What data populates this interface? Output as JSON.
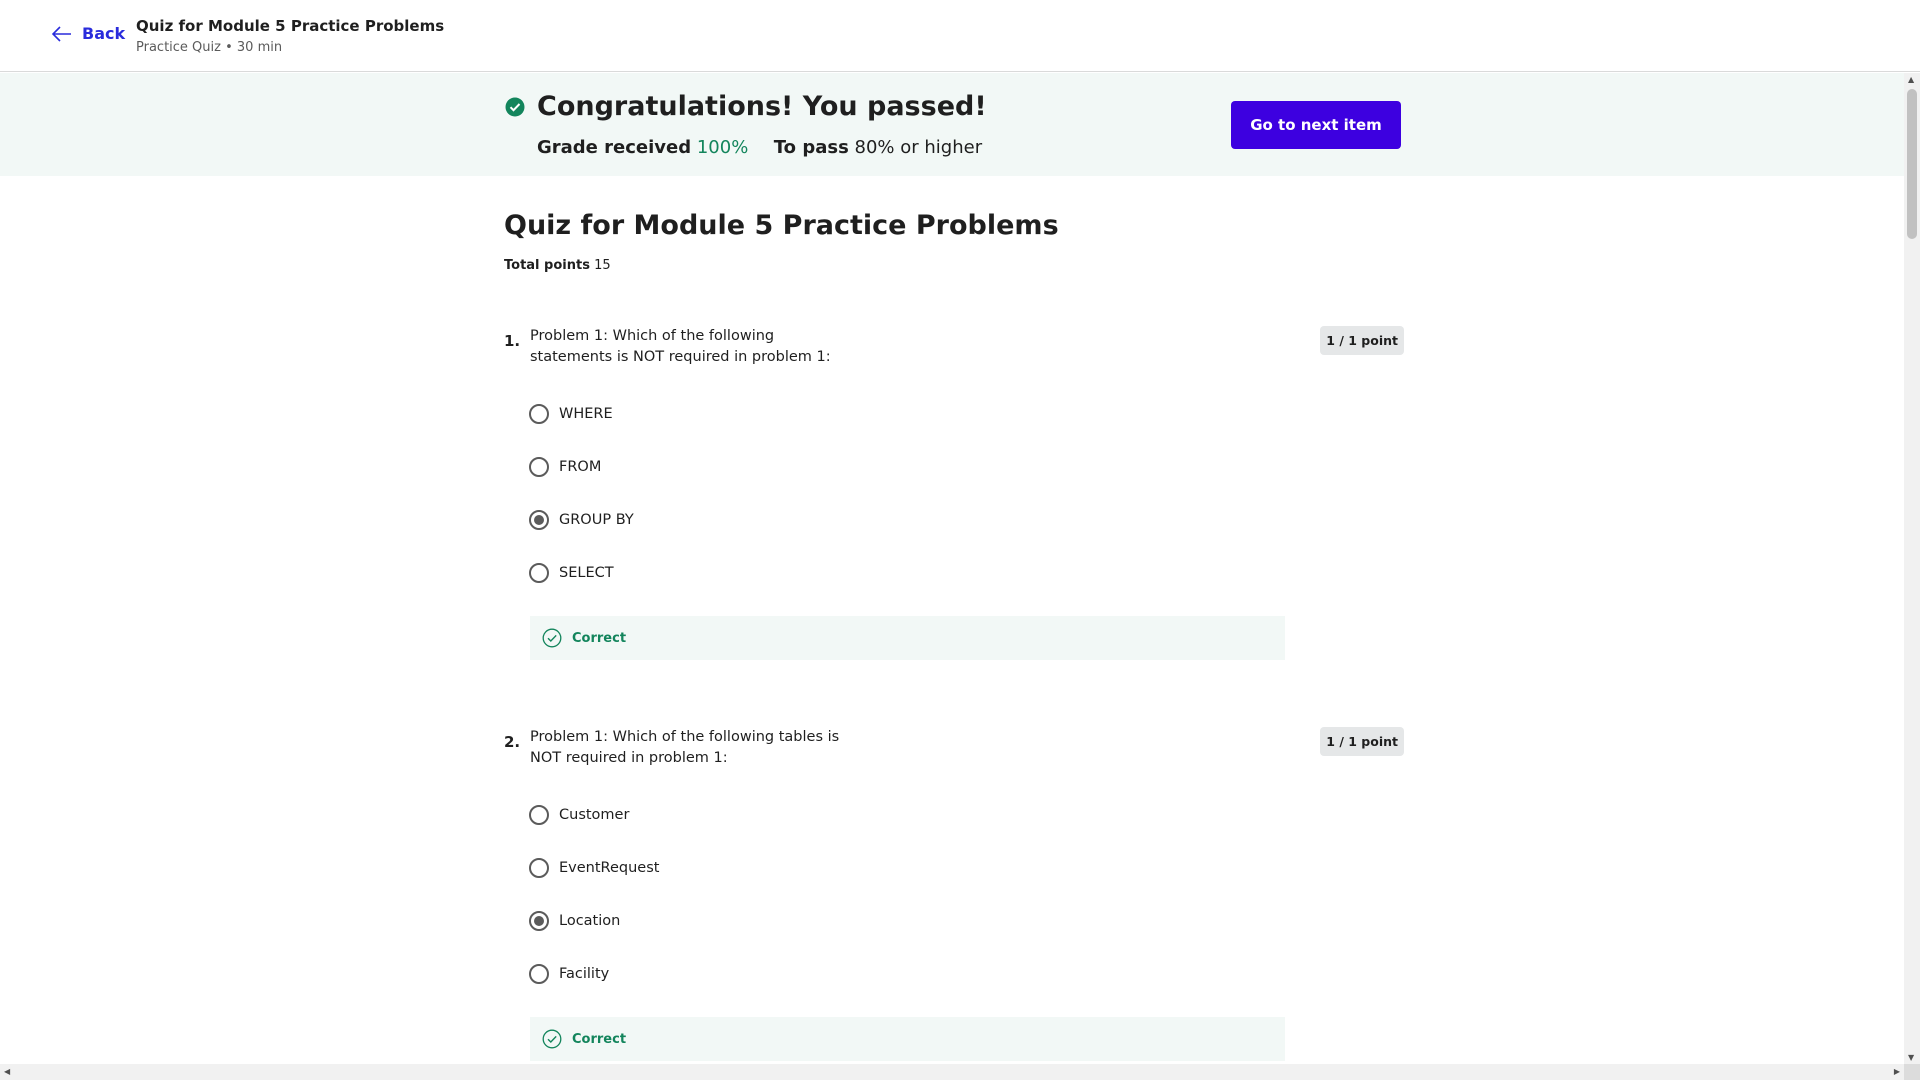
{
  "header": {
    "back_label": "Back",
    "title": "Quiz for Module 5 Practice Problems",
    "subtitle": "Practice Quiz • 30 min"
  },
  "banner": {
    "title": "Congratulations! You passed!",
    "grade_label": "Grade received",
    "grade_value": "100%",
    "pass_label": "To pass",
    "pass_value": "80% or higher",
    "next_button": "Go to next item",
    "success_color": "#13855c",
    "button_color": "#3d00e0"
  },
  "quiz": {
    "title": "Quiz for Module 5 Practice Problems",
    "total_points_label": "Total points",
    "total_points_value": "15"
  },
  "questions": [
    {
      "number": "1.",
      "text": "Problem 1: Which of the following statements is NOT required in problem 1:",
      "points": "1 / 1 point",
      "options": [
        "WHERE",
        "FROM",
        "GROUP BY",
        "SELECT"
      ],
      "selected_index": 2,
      "feedback": "Correct"
    },
    {
      "number": "2.",
      "text": "Problem 1: Which of the following tables is NOT required in problem 1:",
      "points": "1 / 1 point",
      "options": [
        "Customer",
        "EventRequest",
        "Location",
        "Facility"
      ],
      "selected_index": 2,
      "feedback": "Correct"
    }
  ]
}
